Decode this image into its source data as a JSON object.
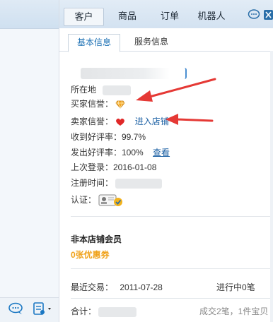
{
  "top_tabs": [
    {
      "label": "客户",
      "active": true
    },
    {
      "label": "商品",
      "active": false
    },
    {
      "label": "订单",
      "active": false
    },
    {
      "label": "机器人",
      "active": false
    }
  ],
  "sub_tabs": [
    {
      "label": "基本信息",
      "active": true
    },
    {
      "label": "服务信息",
      "active": false
    }
  ],
  "info": {
    "location_label": "所在地",
    "buyer_rep_label": "买家信誉：",
    "seller_rep_label": "卖家信誉：",
    "enter_shop": "进入店铺",
    "received_rate": "收到好评率：99.7%",
    "given_rate": "发出好评率：100%",
    "view_link": "查看",
    "last_login": "上次登录：2016-01-08",
    "register_label": "注册时间：",
    "certify_label": "认证："
  },
  "member": {
    "title": "非本店铺会员",
    "coupon": "0张优惠券"
  },
  "recent": {
    "label": "最近交易：",
    "date": "2011-07-28",
    "status": "进行中0笔"
  },
  "total": {
    "label": "合计：",
    "summary": "成交2笔，1件宝贝"
  },
  "colors": {
    "accent": "#1a6fb3",
    "coupon": "#f0a21a",
    "arrow": "#e53935"
  }
}
